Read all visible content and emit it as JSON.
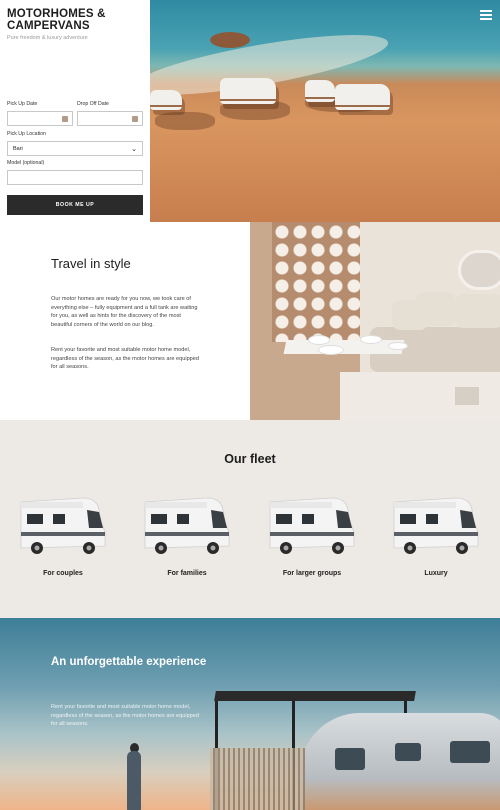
{
  "brand": {
    "title": "MOTORHOMES & CAMPERVANS",
    "tagline": "Pure freedom & luxury adventure"
  },
  "booking": {
    "pickup_date_label": "Pick Up Date",
    "dropoff_date_label": "Drop Off Date",
    "pickup_location_label": "Pick Up Location",
    "pickup_location_value": "Bari",
    "model_label": "Model (optional)",
    "submit_label": "BOOK ME UP"
  },
  "travel": {
    "title": "Travel in style",
    "paragraph1": "Our motor homes are ready for you now, we took care of everything else – fully equipment and a full tank are waiting for you, as well as hints for the discovery of the most beautiful corners of the world on our blog.",
    "paragraph2": "Rent your favorite and most suitable motor home model, regardless of the season, as the motor homes are equipped for all seasons."
  },
  "fleet": {
    "title": "Our fleet",
    "items": [
      {
        "label": "For couples"
      },
      {
        "label": "For families"
      },
      {
        "label": "For larger groups"
      },
      {
        "label": "Luxury"
      }
    ]
  },
  "experience": {
    "title": "An unforgettable experience",
    "paragraph": "Rent your favorite and most suitable motor home model, regardless of the season, as the motor homes are equipped for all seasons."
  },
  "icons": {
    "menu": "hamburger-menu-icon",
    "calendar": "calendar-icon",
    "dropdown": "chevron-down-icon"
  }
}
